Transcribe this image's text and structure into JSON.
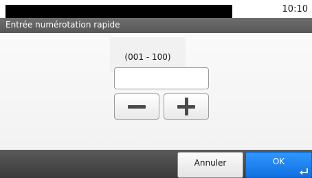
{
  "status_bar": {
    "time": "10:10"
  },
  "header": {
    "title": "Entrée numérotation rapide"
  },
  "speed_dial": {
    "range_label": "(001 - 100)",
    "value": "",
    "decrement_icon": "minus-icon",
    "increment_icon": "plus-icon"
  },
  "footer": {
    "cancel_label": "Annuler",
    "ok_label": "OK",
    "ok_icon": "enter-icon"
  },
  "colors": {
    "accent": "#1e82f0",
    "title_bar": "#626262",
    "footer": "#444444"
  }
}
